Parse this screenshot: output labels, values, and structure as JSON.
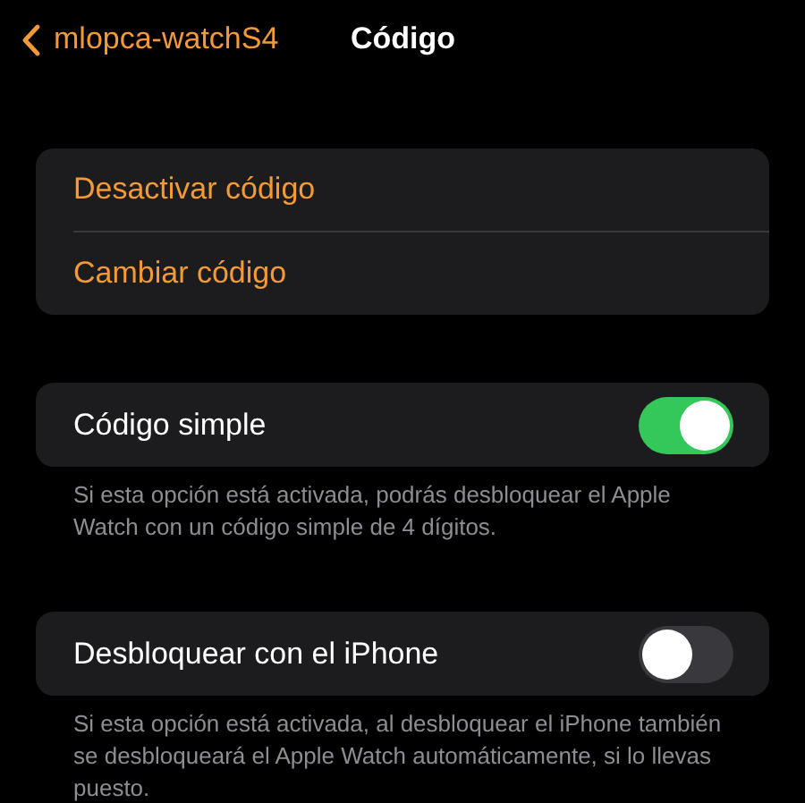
{
  "header": {
    "back_label": "mlopca-watchS4",
    "title": "Código"
  },
  "actions": [
    {
      "label": "Desactivar código"
    },
    {
      "label": "Cambiar código"
    }
  ],
  "toggles": [
    {
      "label": "Código simple",
      "on": true,
      "footer": "Si esta opción está activada, podrás desbloquear el Apple Watch con un código simple de 4 dígitos."
    },
    {
      "label": "Desbloquear con el iPhone",
      "on": false,
      "footer": "Si esta opción está activada, al desbloquear el iPhone también se desbloqueará el Apple Watch automáticamente, si lo llevas puesto."
    }
  ]
}
